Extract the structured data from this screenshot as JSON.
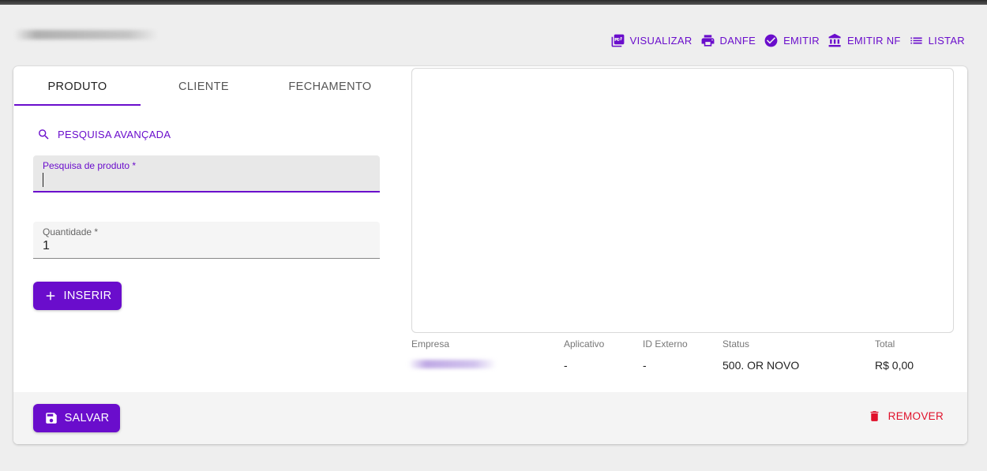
{
  "toolbar": {
    "visualizar": {
      "label": "VISUALIZAR",
      "icon": "pdf-icon"
    },
    "danfe": {
      "label": "DANFE",
      "icon": "printer-icon"
    },
    "emitir": {
      "label": "EMITIR",
      "icon": "check-circle-icon"
    },
    "emitir_nf": {
      "label": "EMITIR NF",
      "icon": "bank-icon"
    },
    "listar": {
      "label": "LISTAR",
      "icon": "list-icon"
    }
  },
  "tabs": [
    {
      "label": "PRODUTO",
      "active": true
    },
    {
      "label": "CLIENTE",
      "active": false
    },
    {
      "label": "FECHAMENTO",
      "active": false
    }
  ],
  "form": {
    "advanced_search_label": "PESQUISA AVANÇADA",
    "product_search": {
      "label": "Pesquisa de produto *",
      "value": ""
    },
    "quantity": {
      "label": "Quantidade *",
      "value": "1"
    },
    "insert_label": "INSERIR"
  },
  "summary": {
    "headers": {
      "empresa": "Empresa",
      "aplicativo": "Aplicativo",
      "id_externo": "ID Externo",
      "status": "Status",
      "total": "Total"
    },
    "values": {
      "aplicativo": "-",
      "id_externo": "-",
      "status": "500. OR NOVO",
      "total": "R$ 0,00"
    }
  },
  "footer": {
    "save_label": "SALVAR",
    "remove_label": "REMOVER"
  },
  "colors": {
    "accent": "#6a0dcc",
    "danger": "#e0102a",
    "background": "#eeeeee"
  }
}
